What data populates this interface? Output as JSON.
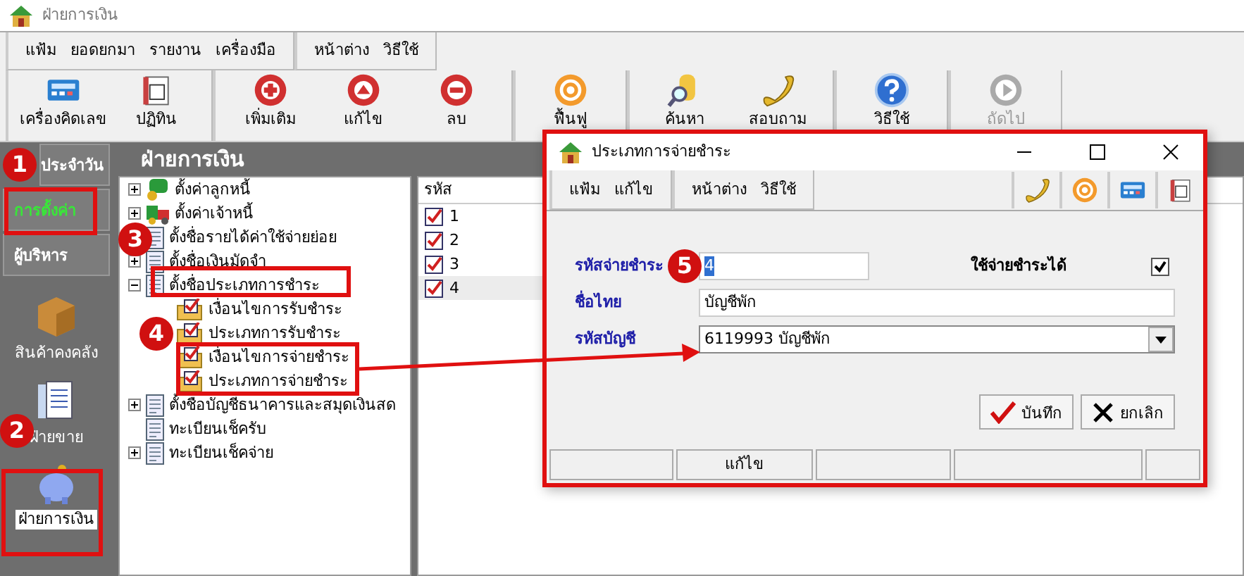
{
  "window": {
    "title": "ฝ่ายการเงิน"
  },
  "menu_groups": [
    [
      "แฟ้ม",
      "ยอดยกมา",
      "รายงาน",
      "เครื่องมือ"
    ],
    [
      "หน้าต่าง",
      "วิธีใช้"
    ]
  ],
  "toolbar": [
    {
      "buttons": [
        {
          "label": "เครื่องคิดเลข",
          "kind": "calculator",
          "disabled": false
        },
        {
          "label": "ปฏิทิน",
          "kind": "calendar",
          "disabled": false
        }
      ]
    },
    {
      "buttons": [
        {
          "label": "เพิ่มเติม",
          "kind": "plus",
          "disabled": false
        },
        {
          "label": "แก้ไข",
          "kind": "up",
          "disabled": false
        },
        {
          "label": "ลบ",
          "kind": "minus",
          "disabled": false
        }
      ]
    },
    {
      "buttons": [
        {
          "label": "ฟื้นฟู",
          "kind": "refresh",
          "disabled": false
        }
      ]
    },
    {
      "buttons": [
        {
          "label": "ค้นหา",
          "kind": "search",
          "disabled": false
        },
        {
          "label": "สอบถาม",
          "kind": "phone",
          "disabled": false
        }
      ]
    },
    {
      "buttons": [
        {
          "label": "วิธีใช้",
          "kind": "help",
          "disabled": false
        }
      ]
    },
    {
      "buttons": [
        {
          "label": "ถัดไป",
          "kind": "next",
          "disabled": true
        }
      ]
    }
  ],
  "sidebar": {
    "tabs": [
      {
        "label": "ประจำวัน",
        "selected": false
      },
      {
        "label": "การตั้งค่า",
        "selected": true
      },
      {
        "label": "ผู้บริหาร",
        "selected": false
      }
    ],
    "items": [
      {
        "label": "สินค้าคงคลัง",
        "kind": "box",
        "selected": false
      },
      {
        "label": "ฝ่ายขาย",
        "kind": "papers",
        "selected": false
      },
      {
        "label": "ฝ่ายการเงิน",
        "kind": "piggy",
        "selected": true
      }
    ]
  },
  "panel": {
    "title": "ฝ่ายการเงิน"
  },
  "tree": [
    {
      "label": "ตั้งค่าลูกหนี้",
      "kind": "people",
      "expanded": false
    },
    {
      "label": "ตั้งค่าเจ้าหนี้",
      "kind": "truck",
      "expanded": false
    },
    {
      "label": "ตั้งชื่อรายได้ค่าใช้จ่ายย่อย",
      "kind": "doc"
    },
    {
      "label": "ตั้งชื่อเงินมัดจำ",
      "kind": "doc",
      "expanded": false
    },
    {
      "label": "ตั้งชื่อประเภทการชำระ",
      "kind": "doc",
      "expanded": true,
      "children": [
        {
          "label": "เงื่อนไขการรับชำระ",
          "kind": "folder"
        },
        {
          "label": "ประเภทการรับชำระ",
          "kind": "folder"
        },
        {
          "label": "เงื่อนไขการจ่ายชำระ",
          "kind": "folder"
        },
        {
          "label": "ประเภทการจ่ายชำระ",
          "kind": "folder"
        }
      ]
    },
    {
      "label": "ตั้งชื่อบัญชีธนาคารและสมุดเงินสด",
      "kind": "doc",
      "expanded": false
    },
    {
      "label": "ทะเบียนเช็ครับ",
      "kind": "doc"
    },
    {
      "label": "ทะเบียนเช็คจ่าย",
      "kind": "doc",
      "expanded": false
    }
  ],
  "list": {
    "column": "รหัส",
    "rows": [
      {
        "code": "1",
        "selected": false
      },
      {
        "code": "2",
        "selected": false
      },
      {
        "code": "3",
        "selected": false
      },
      {
        "code": "4",
        "selected": true
      }
    ]
  },
  "dialog": {
    "title": "ประเภทการจ่ายชำระ",
    "menu_groups": [
      [
        "แฟ้ม",
        "แก้ไข"
      ],
      [
        "หน้าต่าง",
        "วิธีใช้"
      ]
    ],
    "tools": [
      {
        "kind": "phone"
      },
      {
        "kind": "refresh"
      },
      {
        "kind": "calculator"
      },
      {
        "kind": "calendar"
      }
    ],
    "code_label": "รหัสจ่ายชำระ",
    "code_value": "4",
    "code_value_selected": true,
    "allow_label": "ใช้จ่ายชำระได้",
    "allow_checked": true,
    "name_label": "ชื่อไทย",
    "name_value": "บัญชีพัก",
    "account_label": "รหัสบัญชี",
    "account_value": "6119993 บัญชีพัก",
    "buttons": [
      {
        "label": "บันทึก",
        "kind": "save"
      },
      {
        "label": "ยกเลิก",
        "kind": "cancel"
      }
    ],
    "status_text": "แก้ไข"
  },
  "annotations": [
    "1",
    "2",
    "3",
    "4",
    "5"
  ]
}
